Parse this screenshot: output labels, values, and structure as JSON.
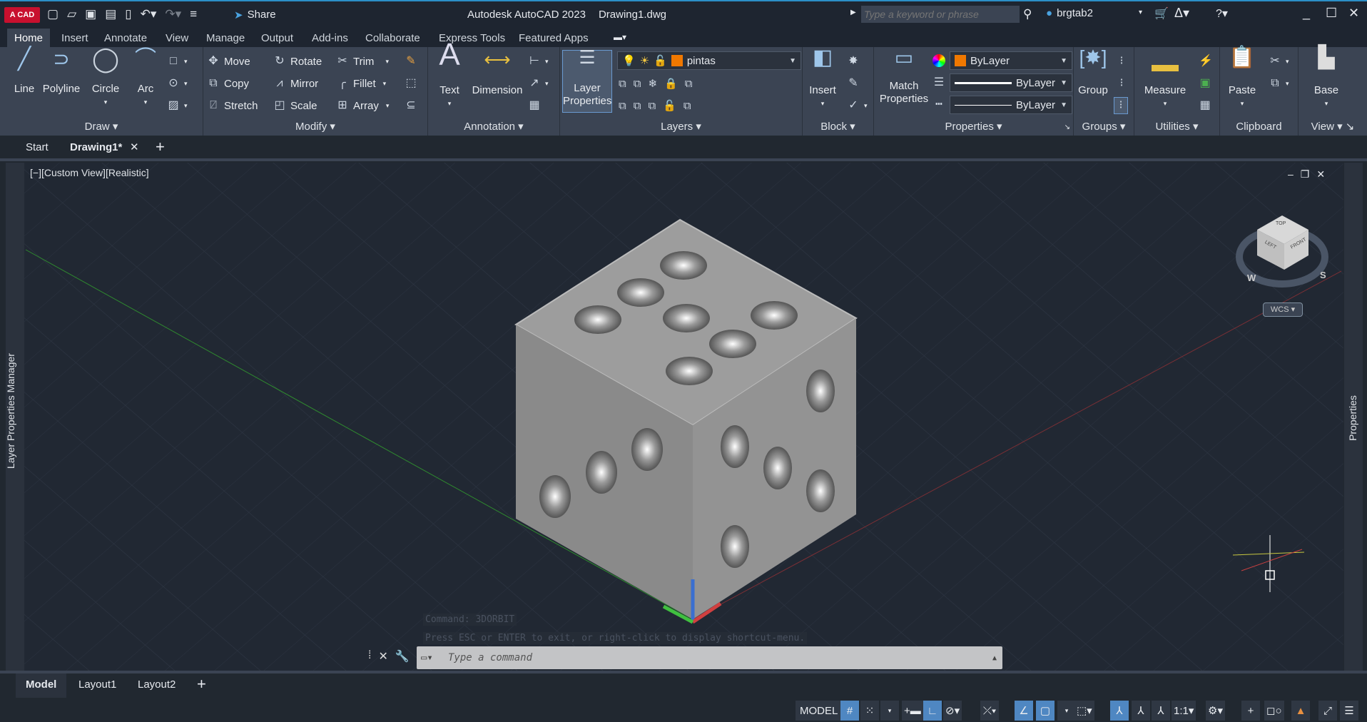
{
  "app": {
    "logo": "A CAD",
    "title": "Autodesk AutoCAD 2023",
    "file": "Drawing1.dwg",
    "share": "Share",
    "search_placeholder": "Type a keyword or phrase",
    "user": "brgtab2"
  },
  "ribbon_tabs": [
    "Home",
    "Insert",
    "Annotate",
    "View",
    "Manage",
    "Output",
    "Add-ins",
    "Collaborate",
    "Express Tools",
    "Featured Apps"
  ],
  "panels": {
    "draw": {
      "label": "Draw",
      "items": [
        "Line",
        "Polyline",
        "Circle",
        "Arc"
      ]
    },
    "modify": {
      "label": "Modify",
      "items": [
        "Move",
        "Rotate",
        "Trim",
        "Copy",
        "Mirror",
        "Fillet",
        "Stretch",
        "Scale",
        "Array"
      ]
    },
    "annotation": {
      "label": "Annotation",
      "items": [
        "Text",
        "Dimension"
      ]
    },
    "layers": {
      "label": "Layers",
      "layer_properties": [
        "Layer",
        "Properties"
      ],
      "current_layer": "pintas"
    },
    "block": {
      "label": "Block",
      "insert": "Insert"
    },
    "properties": {
      "label": "Properties",
      "match": [
        "Match",
        "Properties"
      ],
      "color": "ByLayer",
      "lineweight": "ByLayer",
      "linetype": "ByLayer"
    },
    "groups": {
      "label": "Groups",
      "group": "Group"
    },
    "utilities": {
      "label": "Utilities",
      "measure": "Measure"
    },
    "clipboard": {
      "label": "Clipboard",
      "paste": "Paste"
    },
    "view": {
      "label": "View",
      "base": "Base"
    }
  },
  "doc_tabs": [
    "Start",
    "Drawing1*"
  ],
  "viewport": {
    "label": "[−][Custom View][Realistic]",
    "wcs": "WCS",
    "viewcube": {
      "top": "TOP",
      "left": "LEFT",
      "front": "FRONT",
      "w": "W",
      "s": "S"
    }
  },
  "palettes": {
    "left": "Layer Properties Manager",
    "right": "Properties"
  },
  "command": {
    "history": [
      "Command: 3DORBIT",
      "Press ESC or ENTER to exit, or right-click to display shortcut-menu."
    ],
    "placeholder": "Type a command"
  },
  "layout_tabs": [
    "Model",
    "Layout1",
    "Layout2"
  ],
  "status": {
    "model": "MODEL",
    "scale": "1:1"
  },
  "colors": {
    "accent": "#4f87c2",
    "layer_color": "#f07800",
    "background": "#212833"
  }
}
